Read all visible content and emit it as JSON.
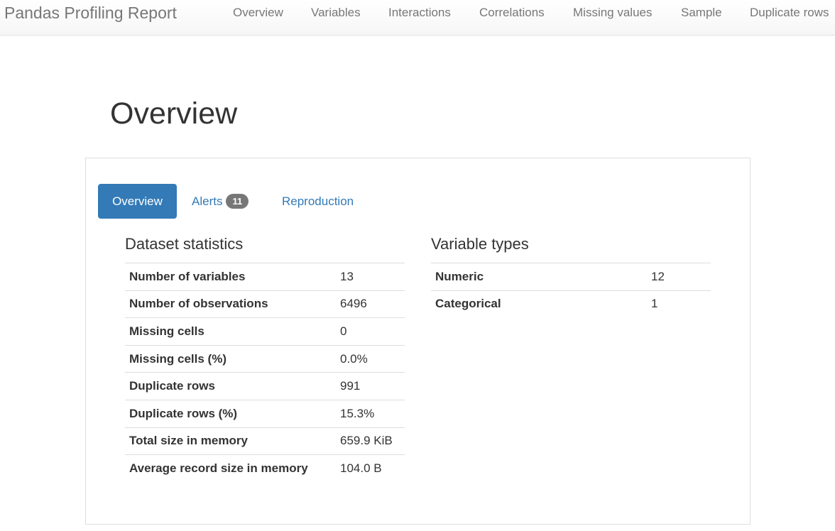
{
  "navbar": {
    "brand": "Pandas Profiling Report",
    "links": [
      "Overview",
      "Variables",
      "Interactions",
      "Correlations",
      "Missing values",
      "Sample",
      "Duplicate rows"
    ]
  },
  "page": {
    "title": "Overview"
  },
  "tabs": {
    "overview": "Overview",
    "alerts": "Alerts",
    "alerts_count": "11",
    "reproduction": "Reproduction"
  },
  "dataset_statistics": {
    "title": "Dataset statistics",
    "rows": [
      {
        "label": "Number of variables",
        "value": "13"
      },
      {
        "label": "Number of observations",
        "value": "6496"
      },
      {
        "label": "Missing cells",
        "value": "0"
      },
      {
        "label": "Missing cells (%)",
        "value": "0.0%"
      },
      {
        "label": "Duplicate rows",
        "value": "991"
      },
      {
        "label": "Duplicate rows (%)",
        "value": "15.3%"
      },
      {
        "label": "Total size in memory",
        "value": "659.9 KiB"
      },
      {
        "label": "Average record size in memory",
        "value": "104.0 B"
      }
    ]
  },
  "variable_types": {
    "title": "Variable types",
    "rows": [
      {
        "label": "Numeric",
        "value": "12"
      },
      {
        "label": "Categorical",
        "value": "1"
      }
    ]
  },
  "colors": {
    "accent": "#337ab7",
    "badge": "#777777",
    "nav_text": "#777777"
  }
}
